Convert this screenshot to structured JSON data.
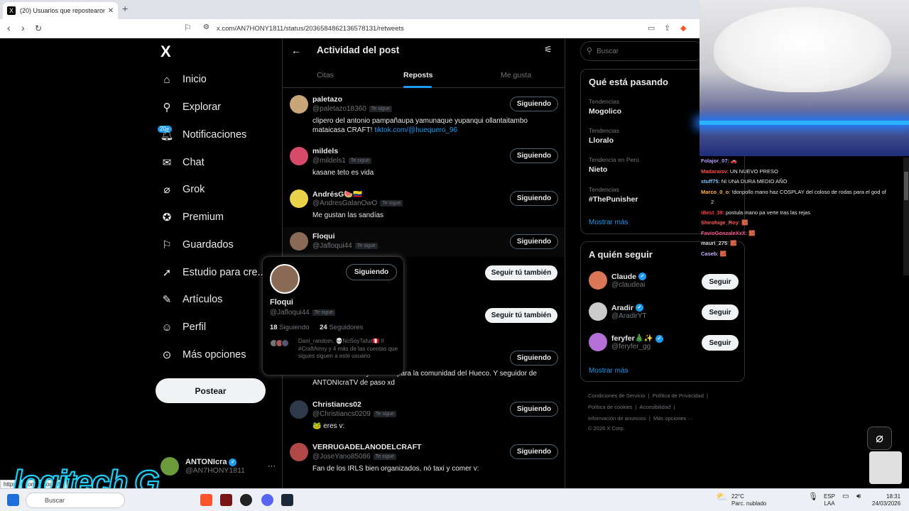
{
  "browser": {
    "tab_title": "(20) Usuarios que repostearon e",
    "url": "x.com/AN7HONY1811/status/2036584862136578131/retweets",
    "status_url": "https://x.com/Jafloqui44"
  },
  "sidebar": {
    "logo": "X",
    "items": [
      {
        "label": "Inicio",
        "icon": "home-icon"
      },
      {
        "label": "Explorar",
        "icon": "search-icon"
      },
      {
        "label": "Notificaciones",
        "icon": "bell-icon"
      },
      {
        "label": "Chat",
        "icon": "mail-icon"
      },
      {
        "label": "Grok",
        "icon": "grok-icon"
      },
      {
        "label": "Premium",
        "icon": "verified-icon"
      },
      {
        "label": "Guardados",
        "icon": "bookmark-icon"
      },
      {
        "label": "Estudio para cre...",
        "icon": "rocket-icon"
      },
      {
        "label": "Artículos",
        "icon": "article-icon"
      },
      {
        "label": "Perfil",
        "icon": "person-icon"
      },
      {
        "label": "Más opciones",
        "icon": "more-circle-icon"
      }
    ],
    "notif_badge": "20+",
    "post_button": "Postear",
    "account": {
      "name": "ANTONIcra",
      "handle": "@AN7HONY1811",
      "menu": "···"
    }
  },
  "main": {
    "title": "Actividad del post",
    "tabs": [
      "Citas",
      "Reposts",
      "Me gusta"
    ],
    "active_tab": "Reposts",
    "follows_you": "Te sigue",
    "users": [
      {
        "name": "paletazo",
        "handle": "@paletazo18360",
        "follows_you": true,
        "bio": "clipero del antonio pampañaupa yamunaque yupanqui ollantaitambo mataicasa CRAFT! ",
        "link": "tiktok.com/@huequero_96",
        "button": "Siguiendo"
      },
      {
        "name": "mildels",
        "handle": "@mildels1",
        "follows_you": true,
        "bio": "kasane teto es vida",
        "button": "Siguiendo"
      },
      {
        "name": "AndrésG🍉🇨🇴",
        "handle": "@AndresGalanOwO",
        "follows_you": true,
        "bio": "Me gustan las sandías",
        "button": "Siguiendo"
      },
      {
        "name": "Floqui",
        "handle": "@Jafloqui44",
        "follows_you": true,
        "bio": "",
        "button": "Siguiendo"
      },
      {
        "name": "",
        "handle": "",
        "bio": "",
        "button": "Seguir tú también"
      },
      {
        "name": "",
        "handle": "",
        "bio": "",
        "button": "Seguir tú también"
      },
      {
        "name": "",
        "handle": "",
        "bio": "Creador de Lore y Memes para la comunidad del Hueco. Y seguidor de ANTONIcraTV de paso xd",
        "button": "Siguiendo"
      },
      {
        "name": "Christiancs02",
        "handle": "@Christiancs0209",
        "follows_you": true,
        "bio": "🐸 eres v:",
        "button": "Siguiendo"
      },
      {
        "name": "VERRUGADELANODELCRAFT",
        "handle": "@JoseYano85086",
        "follows_you": true,
        "bio": "Fan de los IRLS bien organizados, nó taxi y comer v:",
        "button": "Siguiendo"
      }
    ]
  },
  "hover_card": {
    "name": "Floqui",
    "handle": "@Jafloqui44",
    "follows_you": "Te sigue",
    "button": "Siguiendo",
    "following_count": "18",
    "following_label": "Siguiendo",
    "followers_count": "24",
    "followers_label": "Seguidores",
    "followed_by": "Dani_random, 💀NoSoyTafur🇵🇪 II #CraftArmy y 4 más de las cuentas que sigues siguen a este usuario"
  },
  "right": {
    "search_placeholder": "Buscar",
    "trends_title": "Qué está pasando",
    "trends": [
      {
        "context": "Tendencias",
        "name": "Mogolico"
      },
      {
        "context": "Tendencias",
        "name": "Lloralo"
      },
      {
        "context": "Tendencia en Perú",
        "name": "Nieto"
      },
      {
        "context": "Tendencias",
        "name": "#ThePunisher"
      }
    ],
    "show_more": "Mostrar más",
    "who_title": "A quién seguir",
    "who": [
      {
        "name": "Claude",
        "handle": "@claudeai",
        "button": "Seguir",
        "color": "#d97757"
      },
      {
        "name": "Aradir",
        "handle": "@AradirYT",
        "button": "Seguir",
        "color": "#cccccc"
      },
      {
        "name": "feryfer🎄✨",
        "handle": "@feryfer_gg",
        "button": "Seguir",
        "color": "#b56fd6"
      }
    ],
    "footer": [
      "Condiciones de Servicio",
      "Política de Privacidad",
      "Política de cookies",
      "Accesibilidad",
      "Información de anuncios",
      "Más opciones ···",
      "© 2026 X Corp."
    ]
  },
  "stream_chat": [
    {
      "user": "Folajor_07",
      "msg": ": 🚗",
      "color": "#b39cff"
    },
    {
      "user": "Madaraisv",
      "msg": ": UN NUEVO PRESO",
      "color": "#ff4d4d"
    },
    {
      "user": "stuff75",
      "msg": ": NI UNA DURA MEDIO AÑO",
      "color": "#7ec8ff"
    },
    {
      "user": "Marco_0_o",
      "msg": ": !donpollo mano haz COSPLAY del coloso de rodas para el god of",
      "color": "#ffb347"
    },
    {
      "user": "",
      "msg": "2",
      "color": "#ffffff"
    },
    {
      "user": "iBest_39",
      "msg": ": postula mano pa verte tras las rejas",
      "color": "#ff3b3b"
    },
    {
      "user": "Shirohige_Roy",
      "msg": ": 🧱",
      "color": "#ff5a5a"
    },
    {
      "user": "FavioGonzaleXxX",
      "msg": ": 🧱",
      "color": "#ff5a8a"
    },
    {
      "user": "mauri_275",
      "msg": ": 🧱",
      "color": "#d8d8d8"
    },
    {
      "user": "Caseb",
      "msg": ": 🧱",
      "color": "#c9b0ff"
    }
  ],
  "taskbar": {
    "search": "Buscar",
    "weather_temp": "22°C",
    "weather_desc": "Parc. nublado",
    "lang": "ESP",
    "lang2": "LAA",
    "time": "18:31",
    "date": "24/03/2026"
  },
  "overlay_logo": "logitech G",
  "colors": {
    "accent": "#1d9bf0",
    "background": "#000000",
    "muted": "#71767b",
    "border": "#2f3336"
  }
}
